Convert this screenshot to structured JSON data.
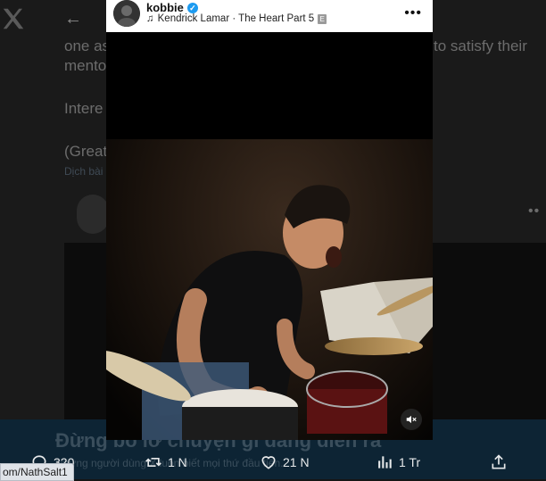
{
  "background": {
    "text_left_1": "one as",
    "text_right_1": "to satisfy their",
    "text_left_2": "mento",
    "text_left_3": "Intere",
    "text_left_4": "(Great",
    "sub_left": "Dịch bài",
    "banner_title": "Đừng bỏ lỡ chuyện gì đang diễn ra",
    "banner_subtitle": "Những người dùng X luôn biết mọi thứ đầu tiên."
  },
  "card": {
    "username": "kobbie",
    "song": "Kendrick Lamar · The Heart Part 5",
    "explicit_badge": "E",
    "more_label": "•••"
  },
  "actions": {
    "reply_count": "320",
    "repost_count": "1 N",
    "like_count": "21 N",
    "views_count": "1 Tr"
  },
  "status_bar": {
    "url": "om/NathSalt1"
  },
  "colors": {
    "verified": "#1d9bf0",
    "banner_bg": "#0d2434"
  }
}
